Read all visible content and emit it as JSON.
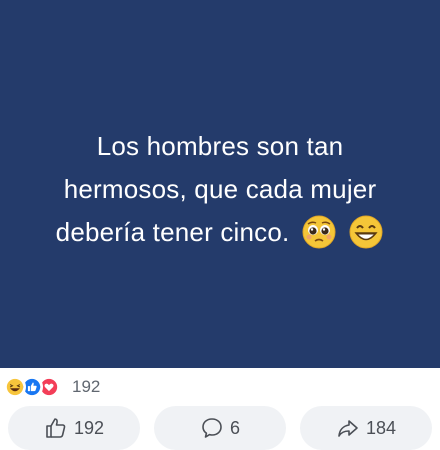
{
  "post": {
    "text_line1": "Los hombres son tan",
    "text_line2": "hermosos, que cada mujer",
    "text_line3": "debería tener  cinco.",
    "emoji_1": "pleading-face",
    "emoji_2": "grinning-face",
    "background_color": "#243b6b"
  },
  "reactions": {
    "icons": [
      "haha-icon",
      "like-icon",
      "love-icon"
    ],
    "count": "192"
  },
  "actions": {
    "like_count": "192",
    "comment_count": "6",
    "share_count": "184"
  }
}
